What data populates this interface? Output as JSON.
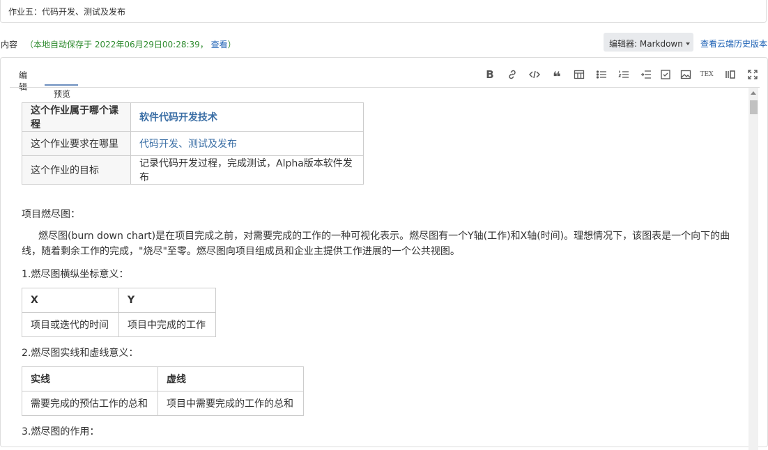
{
  "assignment_title": "作业五：代码开发、测试及发布",
  "content_label": "内容",
  "autosave": {
    "prefix": "（本地自动保存于 2022年06月29日00:28:39，",
    "view_link": "查看",
    "suffix": "）"
  },
  "editor_selector": {
    "label": "编辑器: Markdown"
  },
  "history_link": "查看云端历史版本",
  "tabs": {
    "edit": "编辑",
    "preview": "预览",
    "active": "preview"
  },
  "toolbar": {
    "bold": "B",
    "tex": "TEX",
    "icons": [
      "bold-icon",
      "link-icon",
      "code-icon",
      "quote-icon",
      "table-icon",
      "bullet-list-icon",
      "numbered-list-icon",
      "indent-icon",
      "checkbox-icon",
      "image-icon",
      "tex-icon",
      "split-view-icon",
      "fullscreen-icon"
    ]
  },
  "info_table": {
    "rows": [
      {
        "key": "这个作业属于哪个课程",
        "value": "软件代码开发技术",
        "link": true,
        "bold": true
      },
      {
        "key": "这个作业要求在哪里",
        "value": "代码开发、测试及发布",
        "link": true,
        "bold": false
      },
      {
        "key": "这个作业的目标",
        "value": "记录代码开发过程，完成测试，Alpha版本软件发布",
        "link": false,
        "bold": false
      }
    ]
  },
  "section_burndown": "项目燃尽图：",
  "burndown_paragraph": "燃尽图(burn down chart)是在项目完成之前，对需要完成的工作的一种可视化表示。燃尽图有一个Y轴(工作)和X轴(时间)。理想情况下，该图表是一个向下的曲线，随着剩余工作的完成，\"烧尽\"至零。燃尽图向项目组成员和企业主提供工作进展的一个公共视图。",
  "heading_axes": "1.燃尽图横纵坐标意义：",
  "axes_table": {
    "headers": [
      "X",
      "Y"
    ],
    "row": [
      "项目或迭代的时间",
      "项目中完成的工作"
    ]
  },
  "heading_lines": "2.燃尽图实线和虚线意义：",
  "lines_table": {
    "headers": [
      "实线",
      "虚线"
    ],
    "row": [
      "需要完成的预估工作的总和",
      "项目中需要完成的工作的总和"
    ]
  },
  "heading_purpose": "3.燃尽图的作用："
}
